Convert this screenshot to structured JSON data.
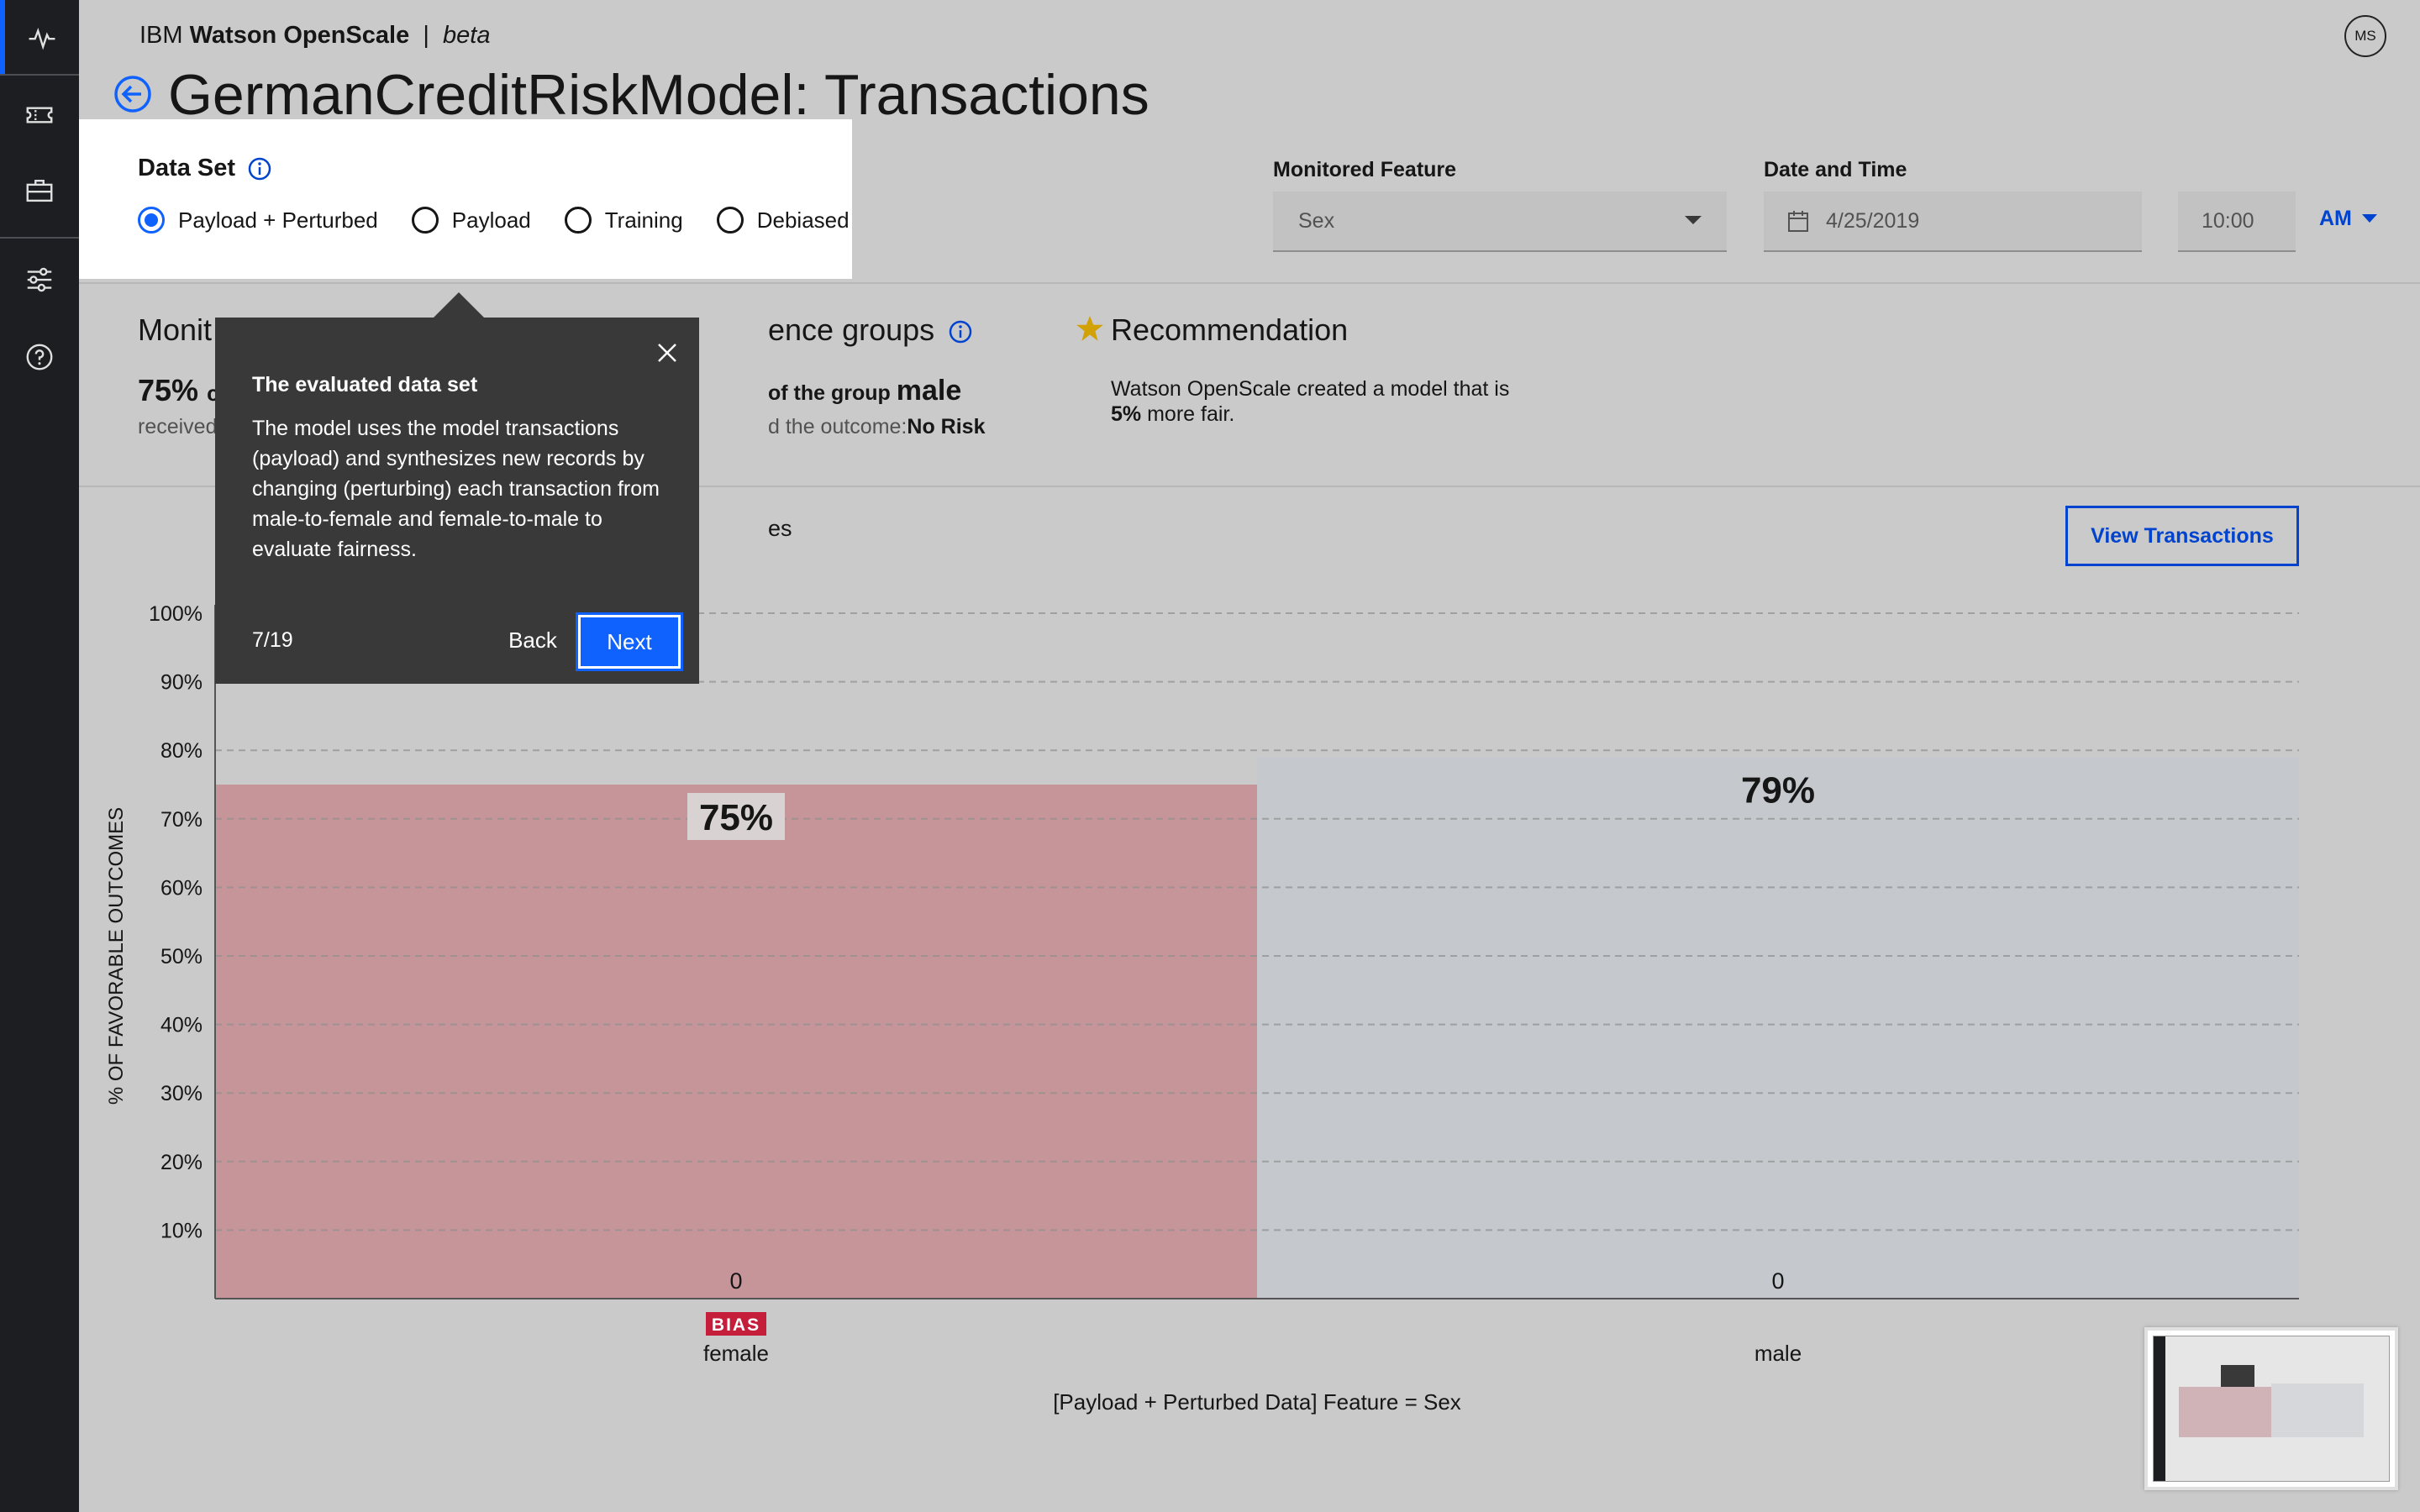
{
  "app": {
    "brand_ibm": "IBM",
    "brand_product": "Watson OpenScale",
    "brand_sep": "|",
    "brand_tag": "beta",
    "avatar_initials": "MS"
  },
  "page": {
    "title": "GermanCreditRiskModel: Transactions"
  },
  "filters": {
    "monitored_feature_label": "Monitored Feature",
    "monitored_feature_value": "Sex",
    "date_time_label": "Date and Time",
    "date_value": "4/25/2019",
    "time_value": "10:00",
    "ampm_value": "AM"
  },
  "dataset": {
    "title": "Data Set",
    "options": [
      "Payload + Perturbed",
      "Payload",
      "Training",
      "Debiased"
    ],
    "selected": "Payload + Perturbed"
  },
  "summary": {
    "monitored_heading_fragment": "Monit",
    "monitored_big_fragment": "75%",
    "monitored_big_tail": "c",
    "monitored_sub_fragment": "received",
    "reference_heading_fragment": "ence groups",
    "reference_line_fragment": "of the group",
    "reference_group": "male",
    "reference_sub_fragment": "d the outcome:",
    "reference_outcome": "No Risk",
    "recommendation_heading": "Recommendation",
    "recommendation_text_line1": "Watson OpenScale created a model that is",
    "recommendation_text_pct": "5%",
    "recommendation_text_tail": "more fair."
  },
  "chart_section": {
    "heading_fragment": "es",
    "view_button": "View Transactions"
  },
  "tour": {
    "title": "The evaluated data set",
    "body": "The model uses the model transactions (payload) and synthesizes new records by changing (perturbing) each transaction from male-to-female and female-to-male to evaluate fairness.",
    "step": "7/19",
    "back_label": "Back",
    "next_label": "Next"
  },
  "colors": {
    "accent": "#0f62fe",
    "bias_bar": "#c6959a",
    "ref_bar": "#c5c8cd",
    "bias_badge": "#c41e3a"
  },
  "icons": {
    "rail": [
      "activity-icon",
      "ticket-icon",
      "briefcase-icon",
      "sliders-icon",
      "help-icon"
    ]
  },
  "chart_data": {
    "type": "bar",
    "categories": [
      "female",
      "male"
    ],
    "values": [
      75,
      79
    ],
    "value_labels": [
      "75%",
      "79%"
    ],
    "count_labels": [
      "0",
      "0"
    ],
    "badges": [
      "BIAS",
      ""
    ],
    "ylabel": "% OF FAVORABLE OUTCOMES",
    "xlabel": "[Payload + Perturbed Data] Feature = Sex",
    "ylim": [
      0,
      100
    ],
    "yticks": [
      "10%",
      "20%",
      "30%",
      "40%",
      "50%",
      "60%",
      "70%",
      "80%",
      "90%",
      "100%"
    ],
    "grid": true
  }
}
